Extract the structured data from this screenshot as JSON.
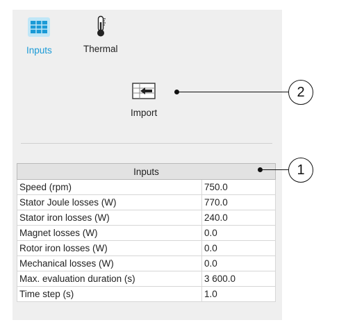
{
  "toolbar": {
    "inputs_label": "Inputs",
    "inputs_icon": "table-grid-icon",
    "thermal_label": "Thermal",
    "thermal_icon": "thermometer-icon",
    "import_label": "Import",
    "import_icon": "import-icon"
  },
  "table": {
    "header": "Inputs",
    "rows": [
      {
        "label": "Speed (rpm)",
        "value": "750.0"
      },
      {
        "label": "Stator Joule losses (W)",
        "value": "770.0"
      },
      {
        "label": "Stator iron losses (W)",
        "value": "240.0"
      },
      {
        "label": "Magnet losses (W)",
        "value": "0.0"
      },
      {
        "label": "Rotor iron losses (W)",
        "value": "0.0"
      },
      {
        "label": "Mechanical losses (W)",
        "value": "0.0"
      },
      {
        "label": "Max. evaluation duration (s)",
        "value": "3 600.0"
      },
      {
        "label": "Time step (s)",
        "value": "1.0"
      }
    ]
  },
  "callouts": {
    "import_number": "2",
    "table_number": "1"
  },
  "colors": {
    "accent": "#1a9ad6",
    "panel_bg": "#efefef",
    "header_bg": "#e2e2e2"
  }
}
